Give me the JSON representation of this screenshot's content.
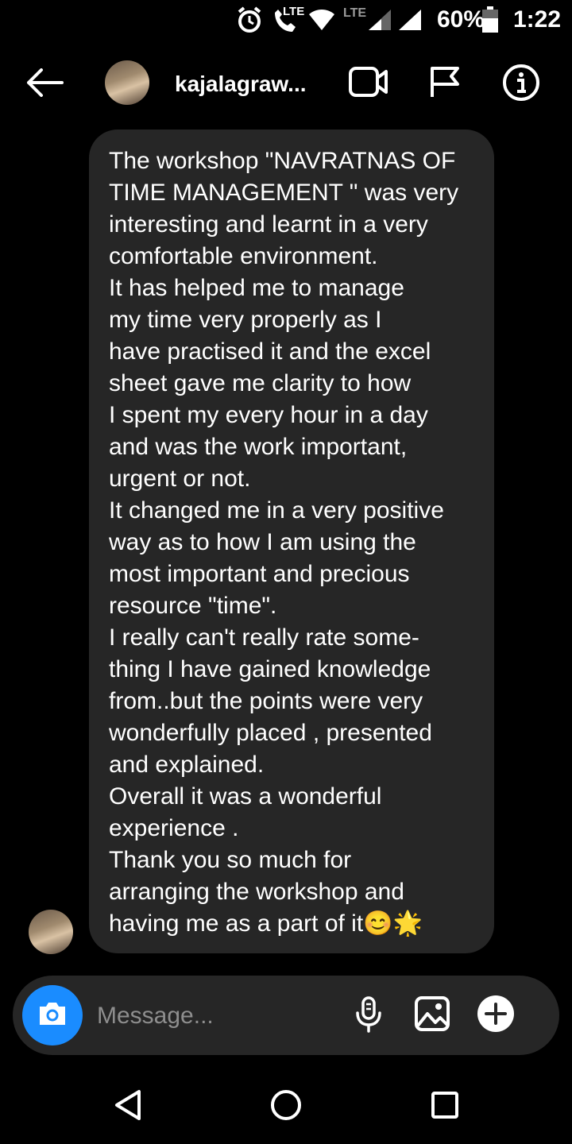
{
  "status_bar": {
    "lte_badge": "LTE",
    "lte_label": "LTE",
    "battery": "60%",
    "time": "1:22",
    "icons": [
      "alarm-icon",
      "volte-call-icon",
      "wifi-icon",
      "signal-icon",
      "signal-icon",
      "battery-icon"
    ]
  },
  "header": {
    "username": "kajalagraw...",
    "icons": [
      "back-arrow-icon",
      "video-call-icon",
      "flag-icon",
      "info-icon"
    ]
  },
  "thread": {
    "message": "The workshop \"NAVRATNAS OF\nTIME MANAGEMENT \" was very\ninteresting and learnt in a very\ncomfortable environment.\nIt has helped me to manage\nmy time very properly as I\nhave practised it and the excel\nsheet gave me clarity to how\nI spent my every hour in a day\nand was the work important,\nurgent or not.\nIt changed me in a very positive\nway as to how I am using the\nmost important and precious\nresource \"time\".\nI really can't really rate some-\nthing I have gained knowledge\nfrom..but the points were very\nwonderfully placed , presented\nand explained.\nOverall it was a wonderful\nexperience .\nThank you so much for\narranging the workshop and\nhaving me as a part of it😊🌟"
  },
  "composer": {
    "placeholder": "Message...",
    "icons": [
      "camera-icon",
      "microphone-icon",
      "gallery-icon",
      "plus-icon"
    ]
  },
  "nav_bar": {
    "icons": [
      "back-triangle-icon",
      "home-circle-icon",
      "recents-square-icon"
    ]
  },
  "colors": {
    "background": "#000000",
    "bubble": "#262626",
    "camera_button": "#1a8cff",
    "placeholder": "#8e8e8e"
  }
}
